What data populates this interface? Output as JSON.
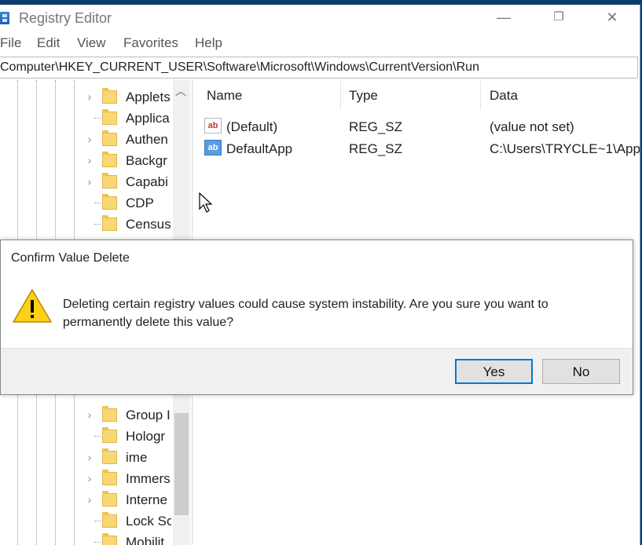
{
  "window": {
    "title": "Registry Editor",
    "controls": {
      "minimize": "—",
      "maximize": "❐",
      "close": "✕"
    }
  },
  "menu": [
    "File",
    "Edit",
    "View",
    "Favorites",
    "Help"
  ],
  "address": "Computer\\HKEY_CURRENT_USER\\Software\\Microsoft\\Windows\\CurrentVersion\\Run",
  "tree": {
    "items_top": [
      {
        "label": "Applets",
        "expandable": true
      },
      {
        "label": "Applica",
        "expandable": false
      },
      {
        "label": "Authen",
        "expandable": true
      },
      {
        "label": "Backgr",
        "expandable": true
      },
      {
        "label": "Capabi",
        "expandable": true
      },
      {
        "label": "CDP",
        "expandable": false
      },
      {
        "label": "Census",
        "expandable": false
      }
    ],
    "items_bottom": [
      {
        "label": "Group I",
        "expandable": true
      },
      {
        "label": "Hologr",
        "expandable": false
      },
      {
        "label": "ime",
        "expandable": true
      },
      {
        "label": "Immers",
        "expandable": true
      },
      {
        "label": "Interne",
        "expandable": true
      },
      {
        "label": "Lock Sc",
        "expandable": false
      },
      {
        "label": "Mobilit",
        "expandable": false
      }
    ]
  },
  "list": {
    "columns": [
      "Name",
      "Type",
      "Data"
    ],
    "rows": [
      {
        "icon": "string-value-icon",
        "name": "(Default)",
        "type": "REG_SZ",
        "data": "(value not set)",
        "selected": false
      },
      {
        "icon": "string-value-icon",
        "name": "DefaultApp",
        "type": "REG_SZ",
        "data": "C:\\Users\\TRYCLE~1\\App",
        "selected": true
      }
    ]
  },
  "dialog": {
    "title": "Confirm Value Delete",
    "message": "Deleting certain registry values could cause system instability. Are you sure you want to permanently delete this value?",
    "yes_label": "Yes",
    "no_label": "No"
  },
  "colors": {
    "desktop": "#0c3c6e",
    "accent": "#0078d7",
    "folder": "#f8d775",
    "warning": "#fcd116"
  }
}
